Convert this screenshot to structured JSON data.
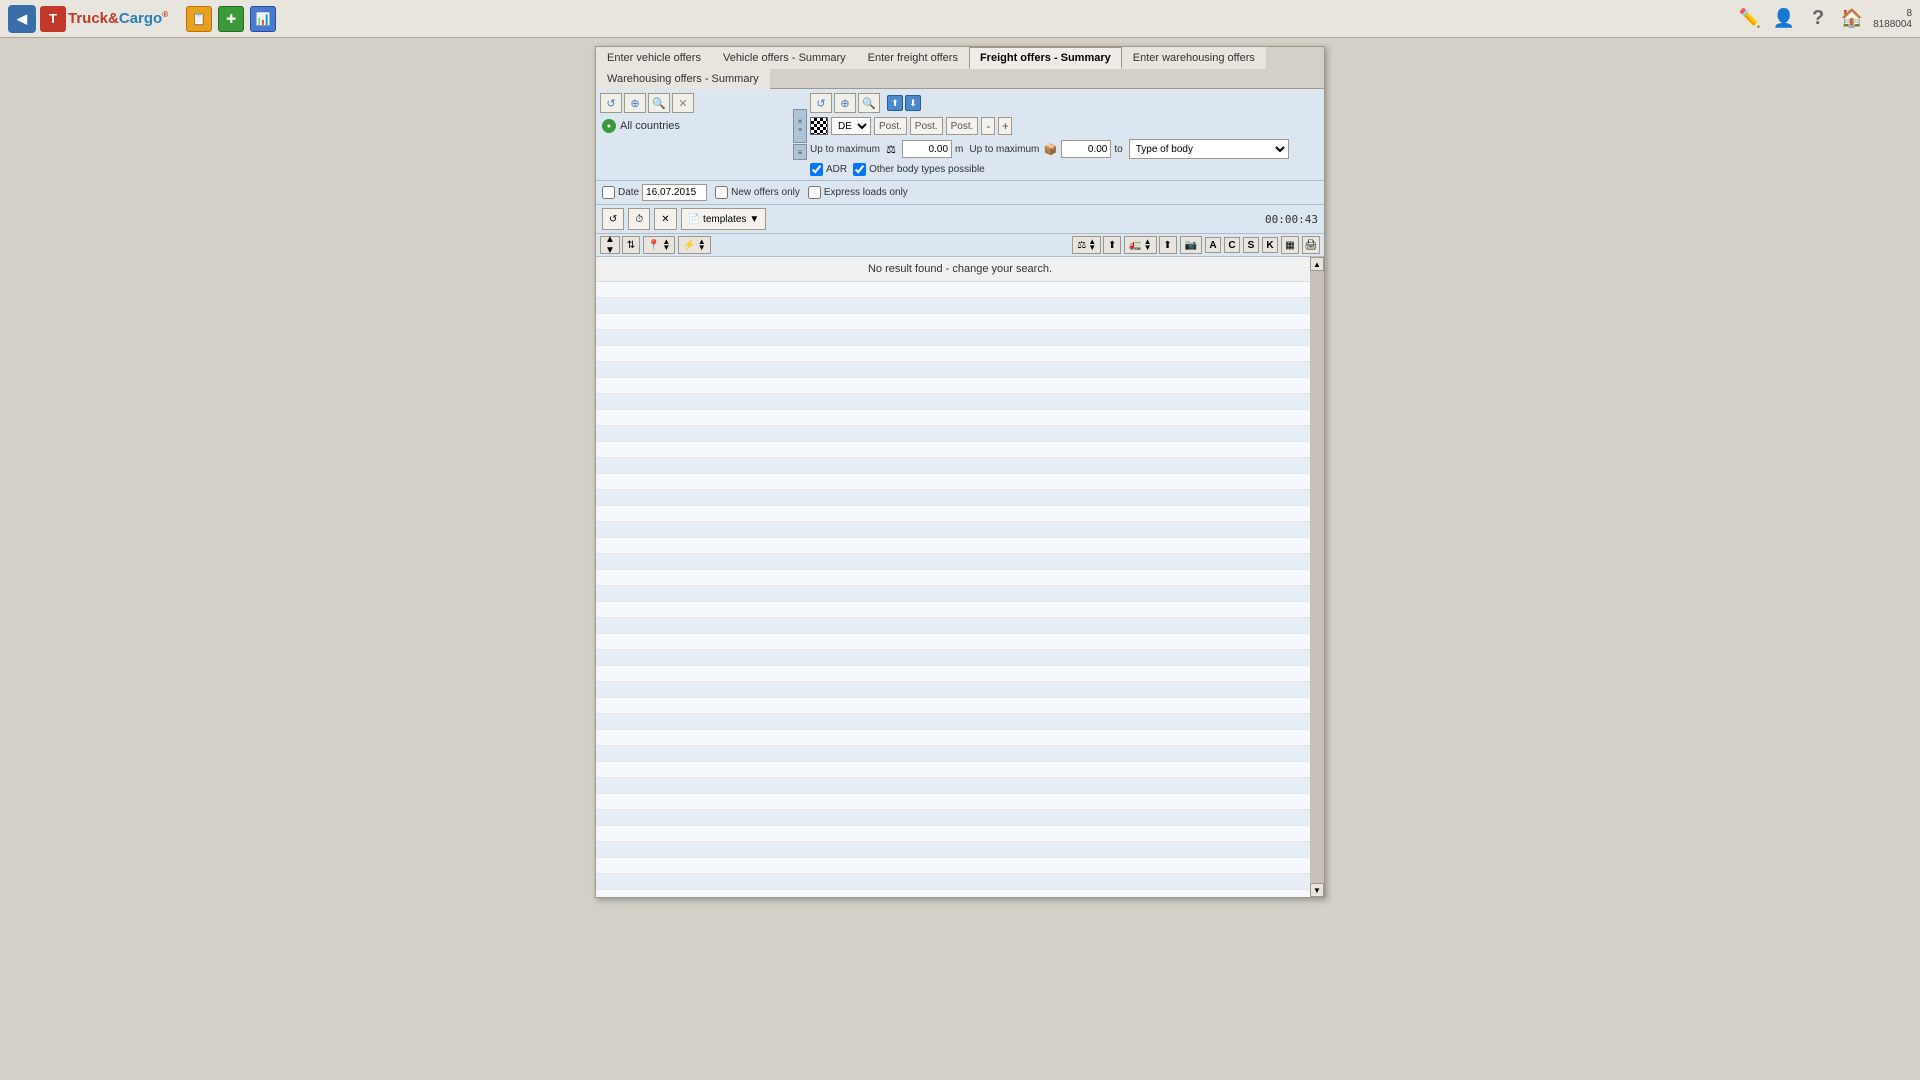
{
  "app": {
    "logo": "Truck&Cargo",
    "logo_reg": "®"
  },
  "topbar": {
    "icons": [
      "📋",
      "🔧",
      "📊"
    ],
    "right_icons": [
      "✏️",
      "👤",
      "❓",
      "🏠"
    ],
    "user_count": "8",
    "user_id": "8188004"
  },
  "tabs": [
    {
      "label": "Enter vehicle offers",
      "active": false
    },
    {
      "label": "Vehicle offers - Summary",
      "active": false
    },
    {
      "label": "Enter freight offers",
      "active": false
    },
    {
      "label": "Freight offers - Summary",
      "active": true
    },
    {
      "label": "Enter warehousing offers",
      "active": false
    },
    {
      "label": "Warehousing offers - Summary",
      "active": false
    }
  ],
  "filter": {
    "left_icons": [
      "↩",
      "⊕",
      "🔍",
      "✕"
    ],
    "country": "All countries",
    "expand_icon": "≡",
    "collapse_icon": "◀",
    "right_top_icons": [
      "↩",
      "⊕",
      "🔍"
    ],
    "country_select": "DE",
    "pos_labels": [
      "Post.",
      "Post.",
      "Post."
    ],
    "max_label_1": "Up to maximum",
    "max_value_1": "0.00",
    "max_unit_1": "m",
    "max_label_2": "Up to maximum",
    "max_value_2": "0.00",
    "max_unit_2": "to",
    "type_of_body_label": "Type of body",
    "type_of_body_placeholder": "Type of body",
    "adr_label": "ADR",
    "other_body_label": "Other body types possible",
    "export_icons": [
      "📥",
      "📤"
    ],
    "date_label": "Date",
    "date_value": "16.07.2015",
    "new_offers_label": "New offers only",
    "express_loads_label": "Express loads only"
  },
  "action_bar": {
    "refresh_btn": "↺",
    "clock_btn": "⏱",
    "clear_btn": "✕",
    "templates_label": "templates",
    "dropdown_arrow": "▼",
    "timer": "00:00:43"
  },
  "columns": {
    "sort_col1": "⇅",
    "sort_col2": "⇅",
    "icon1": "📍",
    "icon2": "⚡",
    "weight_icon": "⚖",
    "volume_icon": "📦",
    "truck_icon": "🚛",
    "letter_a": "A",
    "letter_c": "C",
    "letter_s": "S",
    "letter_k": "K",
    "grid_icon": "▦",
    "print_icon": "🖨"
  },
  "results": {
    "no_result_msg": "No result found - change your search.",
    "empty_rows": 48
  }
}
